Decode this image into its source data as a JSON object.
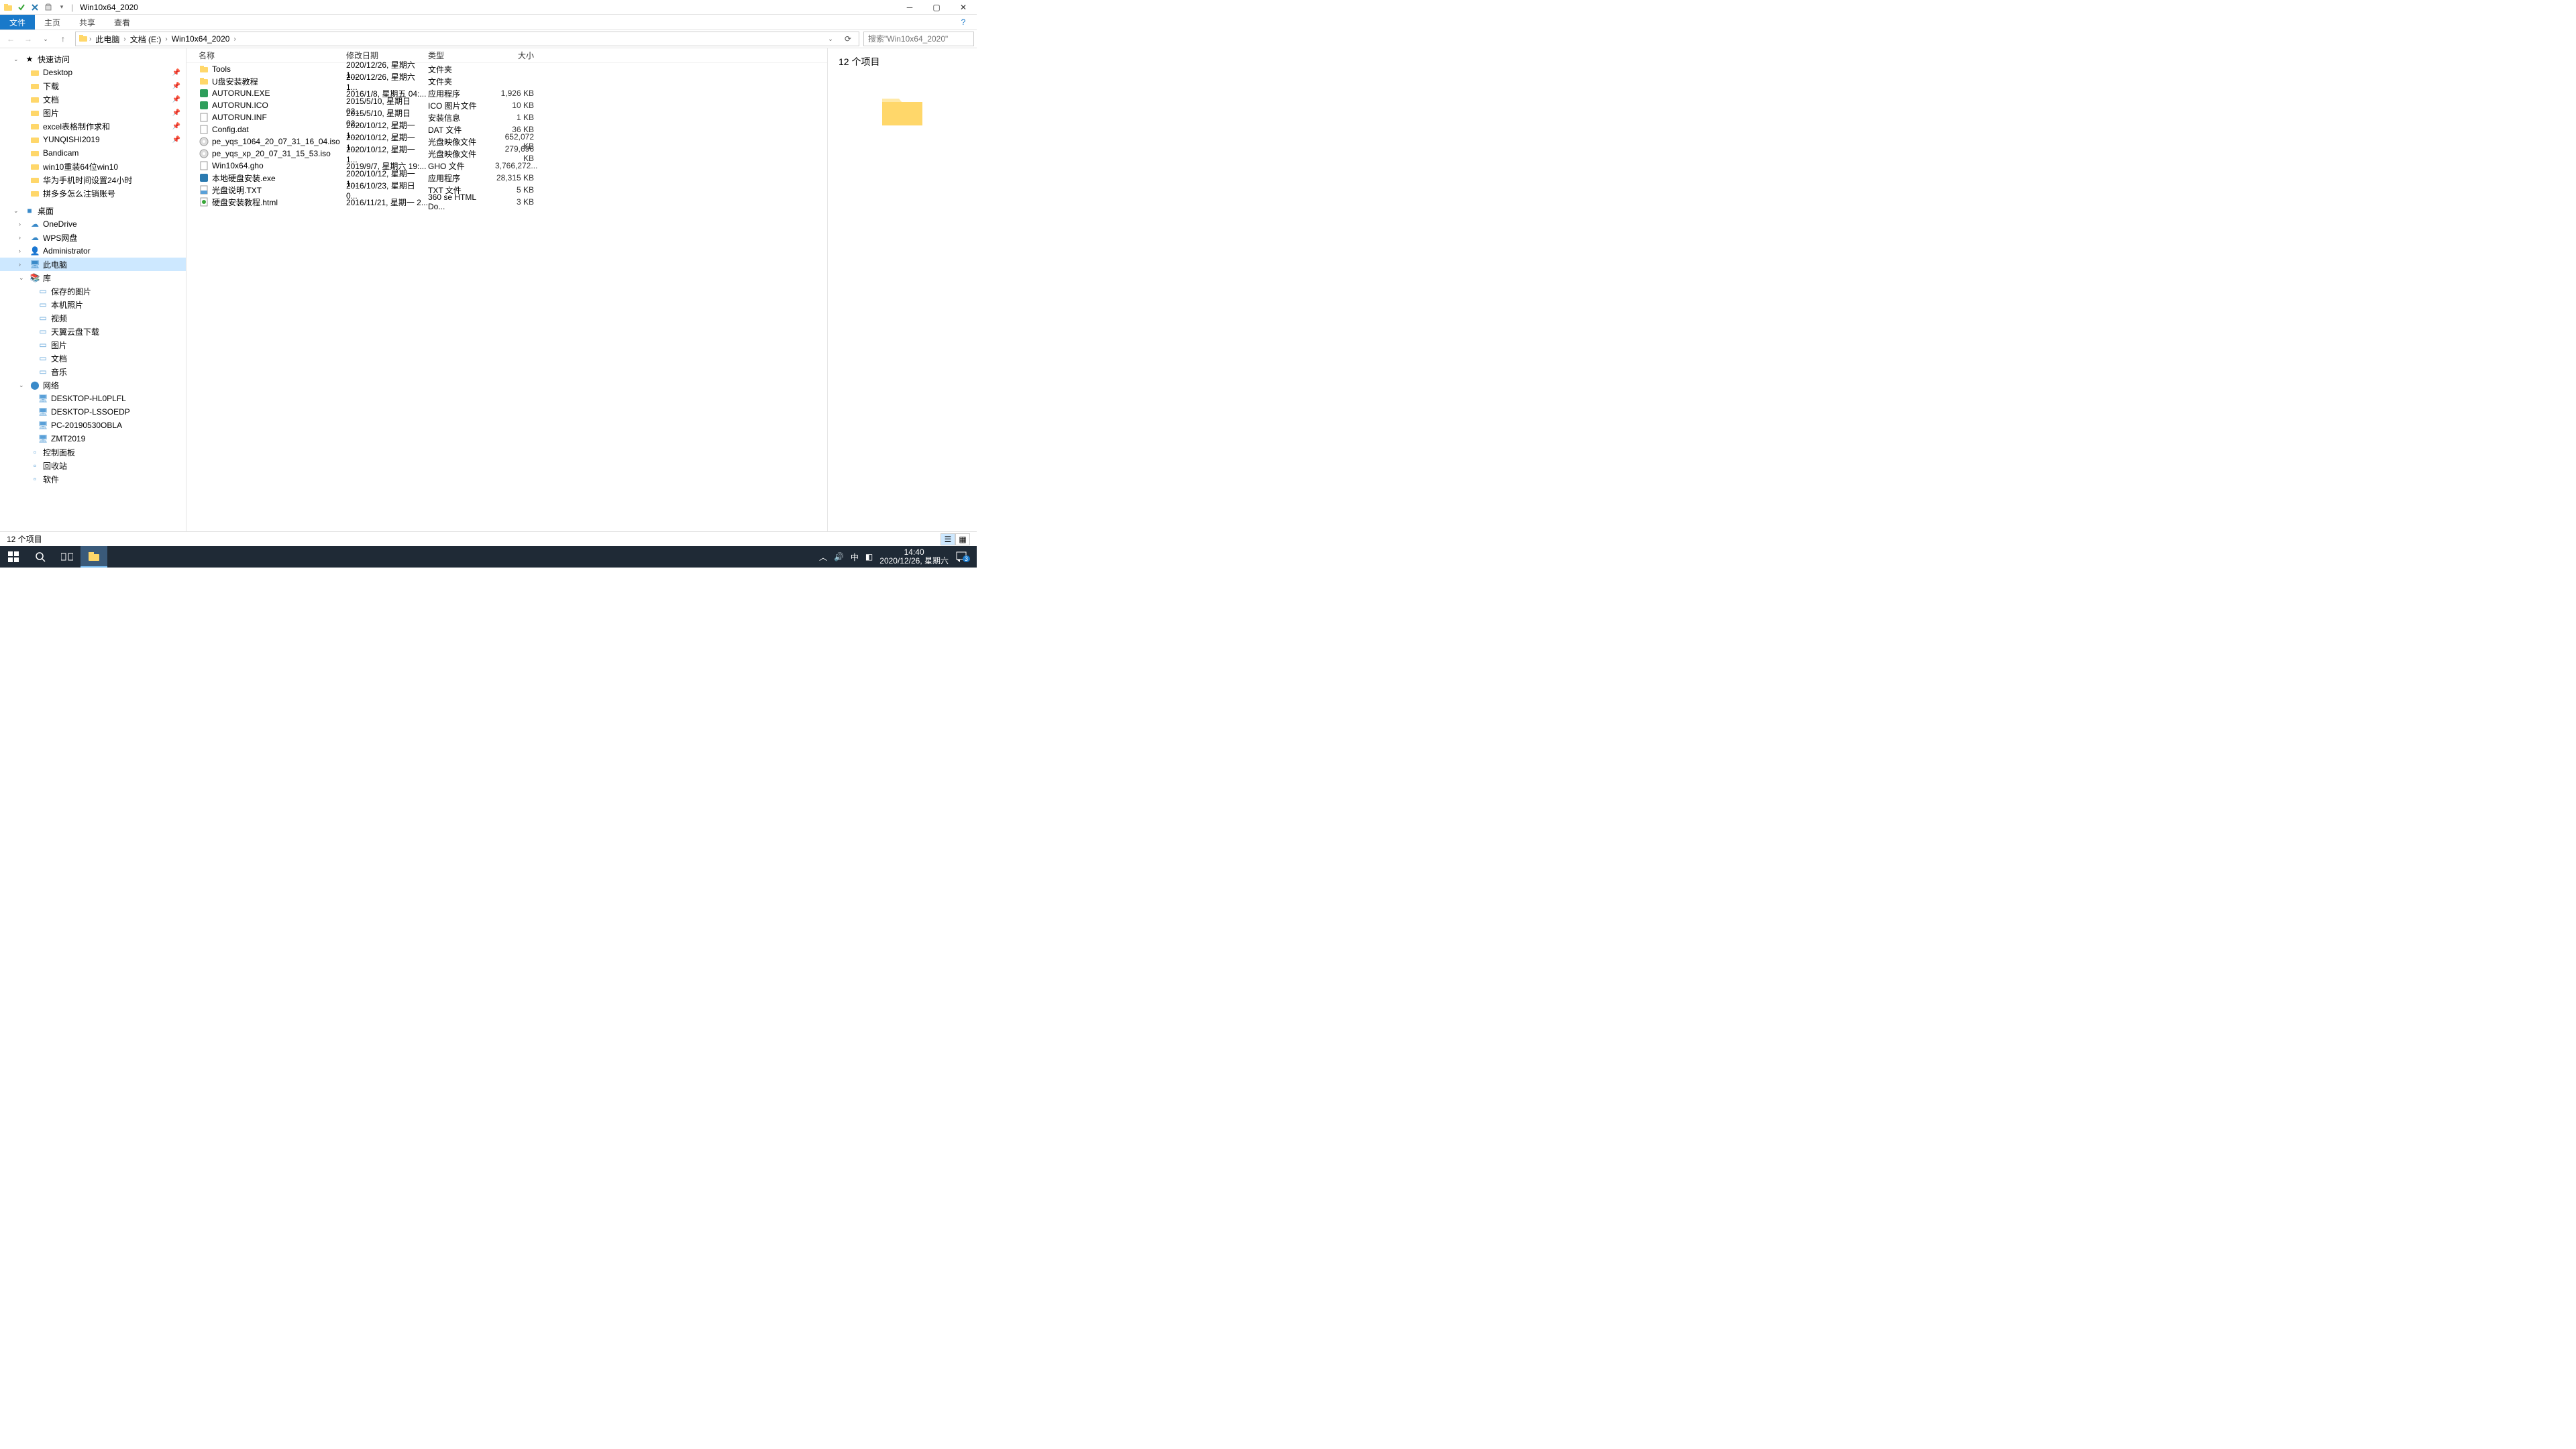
{
  "window": {
    "title": "Win10x64_2020"
  },
  "ribbon": {
    "file": "文件",
    "tabs": [
      "主页",
      "共享",
      "查看"
    ]
  },
  "nav": {
    "crumbs": [
      "此电脑",
      "文档 (E:)",
      "Win10x64_2020"
    ],
    "search_placeholder": "搜索\"Win10x64_2020\""
  },
  "tree": {
    "quick": "快速访问",
    "quick_items": [
      {
        "label": "Desktop",
        "pin": true
      },
      {
        "label": "下载",
        "pin": true
      },
      {
        "label": "文档",
        "pin": true
      },
      {
        "label": "图片",
        "pin": true
      },
      {
        "label": "excel表格制作求和",
        "pin": true
      },
      {
        "label": "YUNQISHI2019",
        "pin": true
      },
      {
        "label": "Bandicam"
      },
      {
        "label": "win10重装64位win10"
      },
      {
        "label": "华为手机时间设置24小时"
      },
      {
        "label": "拼多多怎么注销账号"
      }
    ],
    "desktop": "桌面",
    "desktop_items": [
      "OneDrive",
      "WPS网盘",
      "Administrator",
      "此电脑",
      "库"
    ],
    "lib_items": [
      "保存的图片",
      "本机照片",
      "视频",
      "天翼云盘下载",
      "图片",
      "文档",
      "音乐"
    ],
    "network": "网络",
    "net_items": [
      "DESKTOP-HL0PLFL",
      "DESKTOP-LSSOEDP",
      "PC-20190530OBLA",
      "ZMT2019"
    ],
    "others": [
      "控制面板",
      "回收站",
      "软件"
    ]
  },
  "columns": {
    "name": "名称",
    "date": "修改日期",
    "type": "类型",
    "size": "大小"
  },
  "files": [
    {
      "ic": "folder",
      "name": "Tools",
      "date": "2020/12/26, 星期六 1...",
      "type": "文件夹",
      "size": ""
    },
    {
      "ic": "folder",
      "name": "U盘安装教程",
      "date": "2020/12/26, 星期六 1...",
      "type": "文件夹",
      "size": ""
    },
    {
      "ic": "exe",
      "name": "AUTORUN.EXE",
      "date": "2016/1/8, 星期五 04:...",
      "type": "应用程序",
      "size": "1,926 KB"
    },
    {
      "ic": "exe",
      "name": "AUTORUN.ICO",
      "date": "2015/5/10, 星期日 02...",
      "type": "ICO 图片文件",
      "size": "10 KB"
    },
    {
      "ic": "txt",
      "name": "AUTORUN.INF",
      "date": "2015/5/10, 星期日 02...",
      "type": "安装信息",
      "size": "1 KB"
    },
    {
      "ic": "txt",
      "name": "Config.dat",
      "date": "2020/10/12, 星期一 1...",
      "type": "DAT 文件",
      "size": "36 KB"
    },
    {
      "ic": "iso",
      "name": "pe_yqs_1064_20_07_31_16_04.iso",
      "date": "2020/10/12, 星期一 1...",
      "type": "光盘映像文件",
      "size": "652,072 KB"
    },
    {
      "ic": "iso",
      "name": "pe_yqs_xp_20_07_31_15_53.iso",
      "date": "2020/10/12, 星期一 1...",
      "type": "光盘映像文件",
      "size": "279,696 KB"
    },
    {
      "ic": "txt",
      "name": "Win10x64.gho",
      "date": "2019/9/7, 星期六 19:...",
      "type": "GHO 文件",
      "size": "3,766,272..."
    },
    {
      "ic": "exe2",
      "name": "本地硬盘安装.exe",
      "date": "2020/10/12, 星期一 1...",
      "type": "应用程序",
      "size": "28,315 KB"
    },
    {
      "ic": "txt2",
      "name": "光盘说明.TXT",
      "date": "2016/10/23, 星期日 0...",
      "type": "TXT 文件",
      "size": "5 KB"
    },
    {
      "ic": "html",
      "name": "硬盘安装教程.html",
      "date": "2016/11/21, 星期一 2...",
      "type": "360 se HTML Do...",
      "size": "3 KB"
    }
  ],
  "preview": {
    "count": "12 个项目"
  },
  "status": {
    "text": "12 个项目"
  },
  "taskbar": {
    "time": "14:40",
    "date": "2020/12/26, 星期六",
    "ime": "中",
    "badge": "3"
  }
}
